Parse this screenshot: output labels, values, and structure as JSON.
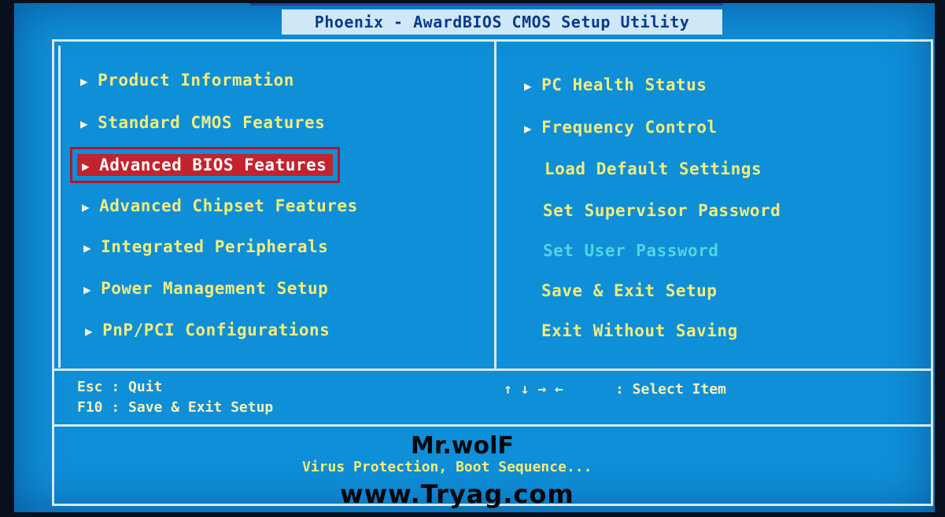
{
  "title": "Phoenix - AwardBIOS CMOS Setup Utility",
  "left_menu": [
    {
      "label": "Product Information",
      "has_submenu": true,
      "selected": false
    },
    {
      "label": "Standard CMOS Features",
      "has_submenu": true,
      "selected": false
    },
    {
      "label": "Advanced BIOS Features",
      "has_submenu": true,
      "selected": true
    },
    {
      "label": "Advanced Chipset Features",
      "has_submenu": true,
      "selected": false
    },
    {
      "label": "Integrated Peripherals",
      "has_submenu": true,
      "selected": false
    },
    {
      "label": "Power Management Setup",
      "has_submenu": true,
      "selected": false
    },
    {
      "label": "PnP/PCI Configurations",
      "has_submenu": true,
      "selected": false
    }
  ],
  "right_menu": [
    {
      "label": "PC Health Status",
      "has_submenu": true,
      "disabled": false
    },
    {
      "label": "Frequency Control",
      "has_submenu": true,
      "disabled": false
    },
    {
      "label": "Load Default Settings",
      "has_submenu": false,
      "disabled": false
    },
    {
      "label": "Set Supervisor Password",
      "has_submenu": false,
      "disabled": false
    },
    {
      "label": "Set User Password",
      "has_submenu": false,
      "disabled": true
    },
    {
      "label": "Save & Exit Setup",
      "has_submenu": false,
      "disabled": false
    },
    {
      "label": "Exit Without Saving",
      "has_submenu": false,
      "disabled": false
    }
  ],
  "help": {
    "esc": "Esc : Quit",
    "f10": "F10 : Save & Exit Setup",
    "nav_keys": "↑ ↓ → ←",
    "select": ": Select Item"
  },
  "description": "Virus Protection, Boot Sequence...",
  "watermark": {
    "author": "Mr.wolF",
    "site": "www.Tryag.com"
  },
  "colors": {
    "background": "#0e8fd8",
    "text": "#f3ec7a",
    "highlight": "#c2232d",
    "disabled": "#56d3e0"
  }
}
